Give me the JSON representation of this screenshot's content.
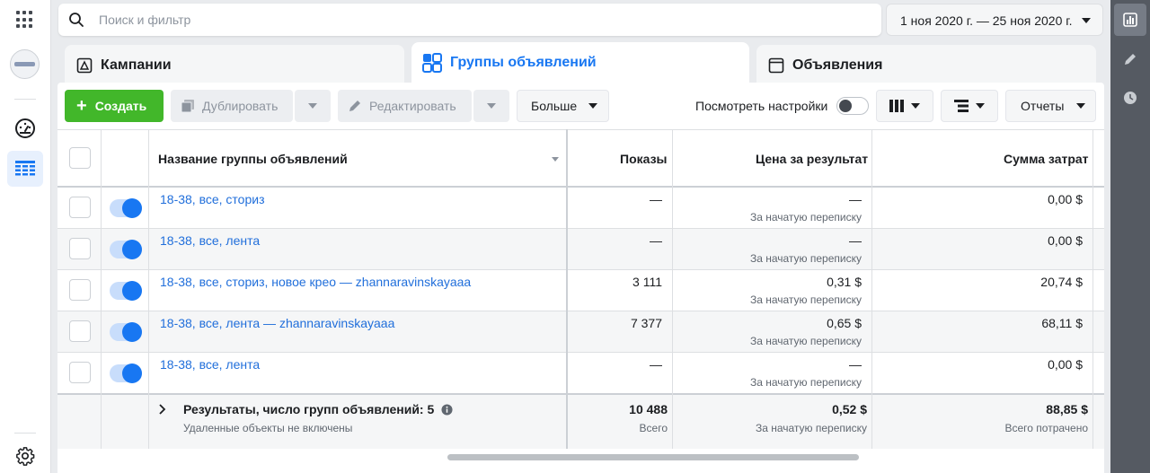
{
  "search": {
    "placeholder": "Поиск и фильтр"
  },
  "date_range": "1 ноя 2020 г. — 25 ноя 2020 г.",
  "tabs": [
    {
      "label": "Кампании"
    },
    {
      "label": "Группы объявлений"
    },
    {
      "label": "Объявления"
    }
  ],
  "toolbar": {
    "create": "Создать",
    "duplicate": "Дублировать",
    "edit": "Редактировать",
    "more": "Больше",
    "view_settings": "Посмотреть настройки",
    "reports": "Отчеты"
  },
  "table": {
    "columns": {
      "name": "Название группы объявлений",
      "impressions": "Показы",
      "cost_per_result": "Цена за результат",
      "amount_spent": "Сумма затрат"
    },
    "rows": [
      {
        "name": "18-38, все, сториз",
        "impressions": "—",
        "cost": "—",
        "cost_sub": "За начатую переписку",
        "spent": "0,00 $"
      },
      {
        "name": "18-38, все, лента",
        "impressions": "—",
        "cost": "—",
        "cost_sub": "За начатую переписку",
        "spent": "0,00 $"
      },
      {
        "name": "18-38, все, сториз, новое крео — zhannaravinskayaaa",
        "impressions": "3 111",
        "cost": "0,31 $",
        "cost_sub": "За начатую переписку",
        "spent": "20,74 $"
      },
      {
        "name": "18-38, все, лента — zhannaravinskayaaa",
        "impressions": "7 377",
        "cost": "0,65 $",
        "cost_sub": "За начатую переписку",
        "spent": "68,11 $"
      },
      {
        "name": "18-38, все, лента",
        "impressions": "—",
        "cost": "—",
        "cost_sub": "За начатую переписку",
        "spent": "0,00 $"
      }
    ],
    "summary": {
      "title": "Результаты, число групп объявлений: 5",
      "subtitle": "Удаленные объекты не включены",
      "impressions": "10 488",
      "impressions_sub": "Всего",
      "cost": "0,52 $",
      "cost_sub": "За начатую переписку",
      "spent": "88,85 $",
      "spent_sub": "Всего потрачено"
    }
  },
  "colors": {
    "accent": "#1877f2",
    "create_green": "#42b72a"
  }
}
